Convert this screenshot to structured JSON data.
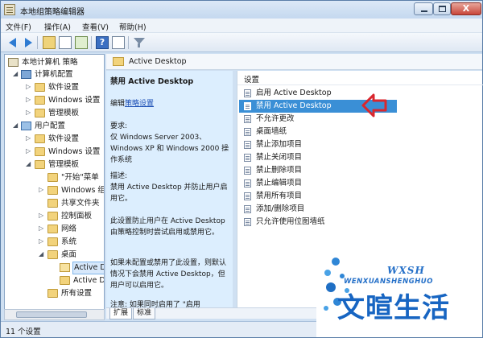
{
  "window": {
    "title": "本地组策略编辑器",
    "controls": {
      "close_glyph": "X"
    }
  },
  "menu": [
    "文件(F)",
    "操作(A)",
    "查看(V)",
    "帮助(H)"
  ],
  "toolbar": {
    "icons": [
      "back-icon",
      "forward-icon",
      "up-folder-icon",
      "show-hide-tree-icon",
      "export-icon",
      "help-icon",
      "properties-icon",
      "filter-icon"
    ],
    "help_glyph": "?"
  },
  "tree": [
    {
      "label": "本地计算机 策略",
      "icon": "policy-icon",
      "expander": ""
    },
    {
      "label": "计算机配置",
      "icon": "computer-icon",
      "expander": "◢"
    },
    {
      "label": "软件设置",
      "icon": "folder-icon",
      "expander": "▷"
    },
    {
      "label": "Windows 设置",
      "icon": "folder-icon",
      "expander": "▷"
    },
    {
      "label": "管理模板",
      "icon": "folder-icon",
      "expander": "▷"
    },
    {
      "label": "用户配置",
      "icon": "user-config-icon",
      "expander": "◢"
    },
    {
      "label": "软件设置",
      "icon": "folder-icon",
      "expander": "▷"
    },
    {
      "label": "Windows 设置",
      "icon": "folder-icon",
      "expander": "▷"
    },
    {
      "label": "管理模板",
      "icon": "folder-icon",
      "expander": "◢"
    },
    {
      "label": "\"开始\"菜单",
      "icon": "folder-icon",
      "expander": ""
    },
    {
      "label": "Windows 组",
      "icon": "folder-icon",
      "expander": "▷"
    },
    {
      "label": "共享文件夹",
      "icon": "folder-icon",
      "expander": ""
    },
    {
      "label": "控制面板",
      "icon": "folder-icon",
      "expander": "▷"
    },
    {
      "label": "网络",
      "icon": "folder-icon",
      "expander": "▷"
    },
    {
      "label": "系统",
      "icon": "folder-icon",
      "expander": "▷"
    },
    {
      "label": "桌面",
      "icon": "folder-icon",
      "expander": "◢"
    },
    {
      "label": "Active De",
      "icon": "folder-open-icon",
      "expander": "",
      "selected": true
    },
    {
      "label": "Active Dir",
      "icon": "folder-icon",
      "expander": ""
    },
    {
      "label": "所有设置",
      "icon": "folder-icon",
      "expander": ""
    }
  ],
  "header": {
    "title": "Active Desktop"
  },
  "description": {
    "heading": "禁用 Active Desktop",
    "edit_prefix": "编辑",
    "edit_link": "策略设置",
    "req_label": "要求:",
    "req_text": "仅 Windows Server 2003、Windows XP 和 Windows 2000 操作系统",
    "desc_label": "描述:",
    "desc_text": "禁用 Active Desktop 并防止用户启用它。",
    "para1": "此设置防止用户在 Active Desktop 由策略控制时尝试启用或禁用它。",
    "para2": "如果未配置或禁用了此设置，则默认情况下会禁用 Active Desktop，但用户可以启用它。",
    "para3": "注意: 如果同时启用了 \"启用"
  },
  "list": {
    "column_header": "设置",
    "items": [
      {
        "label": "启用 Active Desktop"
      },
      {
        "label": "禁用 Active Desktop",
        "selected": true
      },
      {
        "label": "不允许更改"
      },
      {
        "label": "桌面墙纸"
      },
      {
        "label": "禁止添加项目"
      },
      {
        "label": "禁止关闭项目"
      },
      {
        "label": "禁止删除项目"
      },
      {
        "label": "禁止编辑项目"
      },
      {
        "label": "禁用所有项目"
      },
      {
        "label": "添加/删除项目"
      },
      {
        "label": "只允许使用位图墙纸"
      }
    ]
  },
  "tabs": [
    "扩展",
    "标准"
  ],
  "status": {
    "text": "11 个设置"
  },
  "watermark": {
    "top": "WXSH",
    "english": "WENXUANSHENGHUO",
    "chinese": "文暄生活"
  },
  "colors": {
    "selection": "#3a8fd6",
    "desc_background": "#dceefe",
    "annotation_arrow": "#d9272e",
    "watermark_blue": "#1765c2"
  }
}
